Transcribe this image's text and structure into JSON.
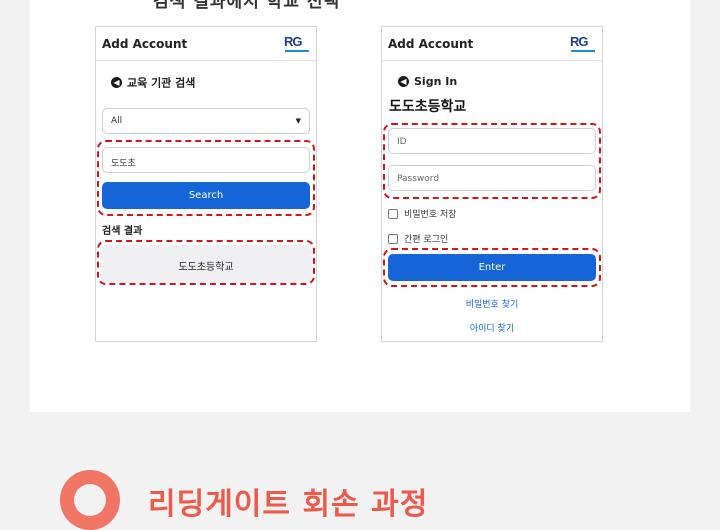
{
  "caption": "검색 결과에서 학교 선택",
  "left_panel": {
    "title": "Add Account",
    "logo": "RG",
    "back_label": "교육 기관 검색",
    "back_icon": "arrow-left-circle-icon",
    "filter_value": "All",
    "search_value": "도도초",
    "search_button": "Search",
    "results_title": "검색 결과",
    "result_item": "도도초등학교"
  },
  "right_panel": {
    "title": "Add Account",
    "logo": "RG",
    "back_label": "Sign In",
    "back_icon": "arrow-left-circle-icon",
    "school_name": "도도초등학교",
    "id_placeholder": "ID",
    "password_placeholder": "Password",
    "save_password_label": "비밀번호 저장",
    "easy_login_label": "간편 로그인",
    "enter_button": "Enter",
    "find_password_link": "비밀번호 찾기",
    "find_id_link": "아이디 찾기"
  },
  "bottom_heading": "리딩게이트 회손 과정",
  "colors": {
    "accent_blue": "#1565d8",
    "highlight_red": "#d2141f",
    "heading_coral": "#ee5a4a"
  }
}
